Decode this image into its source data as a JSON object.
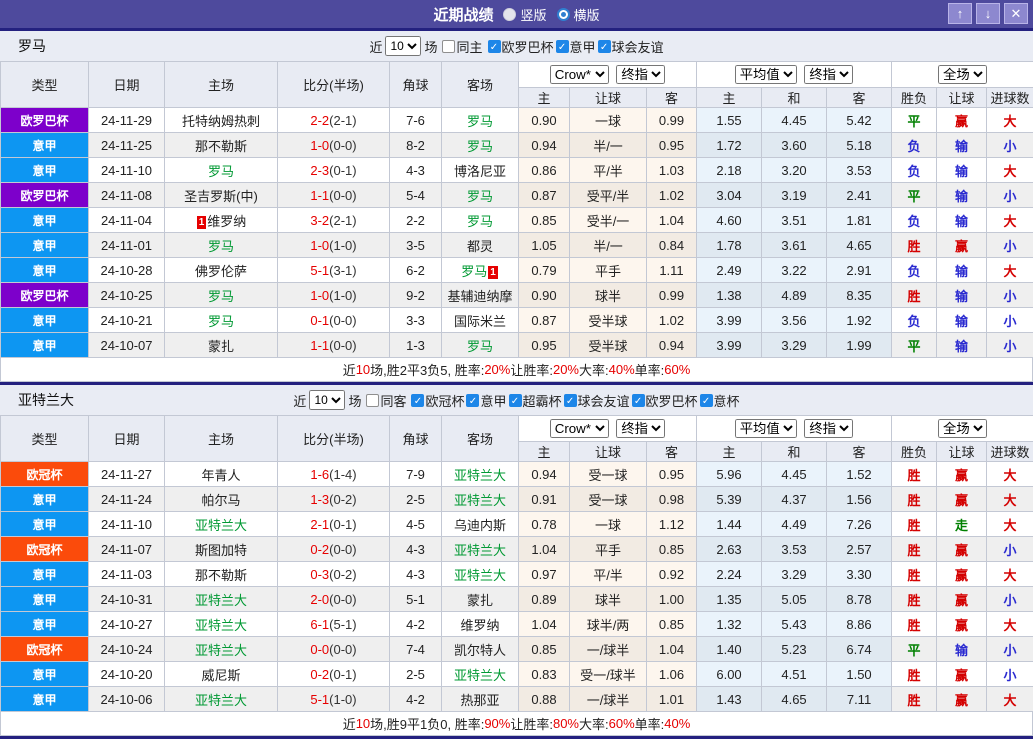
{
  "titlebar": {
    "title": "近期战绩",
    "radios": [
      {
        "label": "竖版",
        "checked": false
      },
      {
        "label": "横版",
        "checked": true
      }
    ],
    "buttons": [
      {
        "name": "move-up",
        "glyph": "↑"
      },
      {
        "name": "move-down",
        "glyph": "↓"
      },
      {
        "name": "close",
        "glyph": "✕"
      }
    ],
    "colors": {
      "bar_bg": "#4e4a9d",
      "button_bg": "#8d88cf"
    }
  },
  "columns": {
    "type": "类型",
    "date": "日期",
    "home": "主场",
    "score": "比分(半场)",
    "corner": "角球",
    "away": "客场",
    "odds_home": "主",
    "odds_handicap": "让球",
    "odds_away": "客",
    "avg_home": "主",
    "avg_draw": "和",
    "avg_away": "客",
    "result": "胜负",
    "handicap_result": "让球",
    "goals": "进球数"
  },
  "selects": {
    "odds_source": "Crow*",
    "odds_time": "终指",
    "avg_source": "平均值",
    "avg_time": "终指",
    "scope": "全场"
  },
  "league_colors": {
    "欧罗巴杯": "#7d00cb",
    "意甲": "#0d96f2",
    "欧冠杯": "#fb4b0b"
  },
  "result_colors": {
    "胜": "#d40000",
    "平": "#008000",
    "负": "#2a2ad0",
    "赢": "#d40000",
    "输": "#2a2ad0",
    "走": "#008000",
    "大": "#d40000",
    "小": "#2a2ad0"
  },
  "sections": [
    {
      "team": "罗马",
      "filter": {
        "near": "近",
        "games": "10",
        "suffix": "场",
        "same": "同主",
        "same_checked": false,
        "leagues": [
          {
            "label": "欧罗巴杯",
            "checked": true
          },
          {
            "label": "意甲",
            "checked": true
          },
          {
            "label": "球会友谊",
            "checked": true
          }
        ]
      },
      "rows": [
        {
          "league": "欧罗巴杯",
          "date": "24-11-29",
          "home": "托特纳姆热刺",
          "away": "罗马",
          "away_hl": true,
          "ft": "2-2",
          "ht": "(2-1)",
          "corner": "7-6",
          "odds": [
            "0.90",
            "一球",
            "0.99"
          ],
          "avg": [
            "1.55",
            "4.45",
            "5.42"
          ],
          "results": [
            "平",
            "赢",
            "大"
          ]
        },
        {
          "league": "意甲",
          "date": "24-11-25",
          "home": "那不勒斯",
          "away": "罗马",
          "away_hl": true,
          "ft": "1-0",
          "ht": "(0-0)",
          "corner": "8-2",
          "odds": [
            "0.94",
            "半/一",
            "0.95"
          ],
          "avg": [
            "1.72",
            "3.60",
            "5.18"
          ],
          "results": [
            "负",
            "输",
            "小"
          ]
        },
        {
          "league": "意甲",
          "date": "24-11-10",
          "home": "罗马",
          "home_hl": true,
          "away": "博洛尼亚",
          "ft": "2-3",
          "ht": "(0-1)",
          "corner": "4-3",
          "odds": [
            "0.86",
            "平/半",
            "1.03"
          ],
          "avg": [
            "2.18",
            "3.20",
            "3.53"
          ],
          "results": [
            "负",
            "输",
            "大"
          ]
        },
        {
          "league": "欧罗巴杯",
          "date": "24-11-08",
          "home": "圣吉罗斯(中)",
          "away": "罗马",
          "away_hl": true,
          "ft": "1-1",
          "ht": "(0-0)",
          "corner": "5-4",
          "odds": [
            "0.87",
            "受平/半",
            "1.02"
          ],
          "avg": [
            "3.04",
            "3.19",
            "2.41"
          ],
          "results": [
            "平",
            "输",
            "小"
          ]
        },
        {
          "league": "意甲",
          "date": "24-11-04",
          "home": "维罗纳",
          "home_card": "1",
          "away": "罗马",
          "away_hl": true,
          "ft": "3-2",
          "ht": "(2-1)",
          "corner": "2-2",
          "odds": [
            "0.85",
            "受半/一",
            "1.04"
          ],
          "avg": [
            "4.60",
            "3.51",
            "1.81"
          ],
          "results": [
            "负",
            "输",
            "大"
          ]
        },
        {
          "league": "意甲",
          "date": "24-11-01",
          "home": "罗马",
          "home_hl": true,
          "away": "都灵",
          "ft": "1-0",
          "ht": "(1-0)",
          "corner": "3-5",
          "odds": [
            "1.05",
            "半/一",
            "0.84"
          ],
          "avg": [
            "1.78",
            "3.61",
            "4.65"
          ],
          "results": [
            "胜",
            "赢",
            "小"
          ]
        },
        {
          "league": "意甲",
          "date": "24-10-28",
          "home": "佛罗伦萨",
          "away": "罗马",
          "away_hl": true,
          "away_card": "1",
          "ft": "5-1",
          "ht": "(3-1)",
          "corner": "6-2",
          "odds": [
            "0.79",
            "平手",
            "1.11"
          ],
          "avg": [
            "2.49",
            "3.22",
            "2.91"
          ],
          "results": [
            "负",
            "输",
            "大"
          ]
        },
        {
          "league": "欧罗巴杯",
          "date": "24-10-25",
          "home": "罗马",
          "home_hl": true,
          "away": "基辅迪纳摩",
          "ft": "1-0",
          "ht": "(1-0)",
          "corner": "9-2",
          "odds": [
            "0.90",
            "球半",
            "0.99"
          ],
          "avg": [
            "1.38",
            "4.89",
            "8.35"
          ],
          "results": [
            "胜",
            "输",
            "小"
          ]
        },
        {
          "league": "意甲",
          "date": "24-10-21",
          "home": "罗马",
          "home_hl": true,
          "away": "国际米兰",
          "ft": "0-1",
          "ht": "(0-0)",
          "corner": "3-3",
          "odds": [
            "0.87",
            "受半球",
            "1.02"
          ],
          "avg": [
            "3.99",
            "3.56",
            "1.92"
          ],
          "results": [
            "负",
            "输",
            "小"
          ]
        },
        {
          "league": "意甲",
          "date": "24-10-07",
          "home": "蒙扎",
          "away": "罗马",
          "away_hl": true,
          "ft": "1-1",
          "ht": "(0-0)",
          "corner": "1-3",
          "odds": [
            "0.95",
            "受半球",
            "0.94"
          ],
          "avg": [
            "3.99",
            "3.29",
            "1.99"
          ],
          "results": [
            "平",
            "输",
            "小"
          ]
        }
      ],
      "summary": [
        [
          "近",
          "k"
        ],
        [
          "10",
          "r"
        ],
        [
          "场,胜2平3负5, 胜率:",
          "k"
        ],
        [
          "20%",
          "r"
        ],
        [
          " 让胜率:",
          "k"
        ],
        [
          "20%",
          "r"
        ],
        [
          " 大率:",
          "k"
        ],
        [
          "40%",
          "r"
        ],
        [
          " 单率:",
          "k"
        ],
        [
          "60%",
          "r"
        ]
      ]
    },
    {
      "team": "亚特兰大",
      "filter": {
        "near": "近",
        "games": "10",
        "suffix": "场",
        "same": "同客",
        "same_checked": false,
        "leagues": [
          {
            "label": "欧冠杯",
            "checked": true
          },
          {
            "label": "意甲",
            "checked": true
          },
          {
            "label": "超霸杯",
            "checked": true
          },
          {
            "label": "球会友谊",
            "checked": true
          },
          {
            "label": "欧罗巴杯",
            "checked": true
          },
          {
            "label": "意杯",
            "checked": true
          }
        ]
      },
      "rows": [
        {
          "league": "欧冠杯",
          "date": "24-11-27",
          "home": "年青人",
          "away": "亚特兰大",
          "away_hl": true,
          "ft": "1-6",
          "ht": "(1-4)",
          "corner": "7-9",
          "odds": [
            "0.94",
            "受一球",
            "0.95"
          ],
          "avg": [
            "5.96",
            "4.45",
            "1.52"
          ],
          "results": [
            "胜",
            "赢",
            "大"
          ]
        },
        {
          "league": "意甲",
          "date": "24-11-24",
          "home": "帕尔马",
          "away": "亚特兰大",
          "away_hl": true,
          "ft": "1-3",
          "ht": "(0-2)",
          "corner": "2-5",
          "odds": [
            "0.91",
            "受一球",
            "0.98"
          ],
          "avg": [
            "5.39",
            "4.37",
            "1.56"
          ],
          "results": [
            "胜",
            "赢",
            "大"
          ]
        },
        {
          "league": "意甲",
          "date": "24-11-10",
          "home": "亚特兰大",
          "home_hl": true,
          "away": "乌迪内斯",
          "ft": "2-1",
          "ht": "(0-1)",
          "corner": "4-5",
          "odds": [
            "0.78",
            "一球",
            "1.12"
          ],
          "avg": [
            "1.44",
            "4.49",
            "7.26"
          ],
          "results": [
            "胜",
            "走",
            "大"
          ]
        },
        {
          "league": "欧冠杯",
          "date": "24-11-07",
          "home": "斯图加特",
          "away": "亚特兰大",
          "away_hl": true,
          "ft": "0-2",
          "ht": "(0-0)",
          "corner": "4-3",
          "odds": [
            "1.04",
            "平手",
            "0.85"
          ],
          "avg": [
            "2.63",
            "3.53",
            "2.57"
          ],
          "results": [
            "胜",
            "赢",
            "小"
          ]
        },
        {
          "league": "意甲",
          "date": "24-11-03",
          "home": "那不勒斯",
          "away": "亚特兰大",
          "away_hl": true,
          "ft": "0-3",
          "ht": "(0-2)",
          "corner": "4-3",
          "odds": [
            "0.97",
            "平/半",
            "0.92"
          ],
          "avg": [
            "2.24",
            "3.29",
            "3.30"
          ],
          "results": [
            "胜",
            "赢",
            "大"
          ]
        },
        {
          "league": "意甲",
          "date": "24-10-31",
          "home": "亚特兰大",
          "home_hl": true,
          "away": "蒙扎",
          "ft": "2-0",
          "ht": "(0-0)",
          "corner": "5-1",
          "odds": [
            "0.89",
            "球半",
            "1.00"
          ],
          "avg": [
            "1.35",
            "5.05",
            "8.78"
          ],
          "results": [
            "胜",
            "赢",
            "小"
          ]
        },
        {
          "league": "意甲",
          "date": "24-10-27",
          "home": "亚特兰大",
          "home_hl": true,
          "away": "维罗纳",
          "ft": "6-1",
          "ht": "(5-1)",
          "corner": "4-2",
          "odds": [
            "1.04",
            "球半/两",
            "0.85"
          ],
          "avg": [
            "1.32",
            "5.43",
            "8.86"
          ],
          "results": [
            "胜",
            "赢",
            "大"
          ]
        },
        {
          "league": "欧冠杯",
          "date": "24-10-24",
          "home": "亚特兰大",
          "home_hl": true,
          "away": "凯尔特人",
          "ft": "0-0",
          "ht": "(0-0)",
          "corner": "7-4",
          "odds": [
            "0.85",
            "一/球半",
            "1.04"
          ],
          "avg": [
            "1.40",
            "5.23",
            "6.74"
          ],
          "results": [
            "平",
            "输",
            "小"
          ]
        },
        {
          "league": "意甲",
          "date": "24-10-20",
          "home": "威尼斯",
          "away": "亚特兰大",
          "away_hl": true,
          "ft": "0-2",
          "ht": "(0-1)",
          "corner": "2-5",
          "odds": [
            "0.83",
            "受一/球半",
            "1.06"
          ],
          "avg": [
            "6.00",
            "4.51",
            "1.50"
          ],
          "results": [
            "胜",
            "赢",
            "小"
          ]
        },
        {
          "league": "意甲",
          "date": "24-10-06",
          "home": "亚特兰大",
          "home_hl": true,
          "away": "热那亚",
          "ft": "5-1",
          "ht": "(1-0)",
          "corner": "4-2",
          "odds": [
            "0.88",
            "一/球半",
            "1.01"
          ],
          "avg": [
            "1.43",
            "4.65",
            "7.11"
          ],
          "results": [
            "胜",
            "赢",
            "大"
          ]
        }
      ],
      "summary": [
        [
          "近",
          "k"
        ],
        [
          "10",
          "r"
        ],
        [
          "场,胜9平1负0, 胜率:",
          "k"
        ],
        [
          "90%",
          "r"
        ],
        [
          " 让胜率:",
          "k"
        ],
        [
          "80%",
          "r"
        ],
        [
          " 大率:",
          "k"
        ],
        [
          "60%",
          "r"
        ],
        [
          " 单率:",
          "k"
        ],
        [
          "40%",
          "r"
        ]
      ]
    }
  ]
}
